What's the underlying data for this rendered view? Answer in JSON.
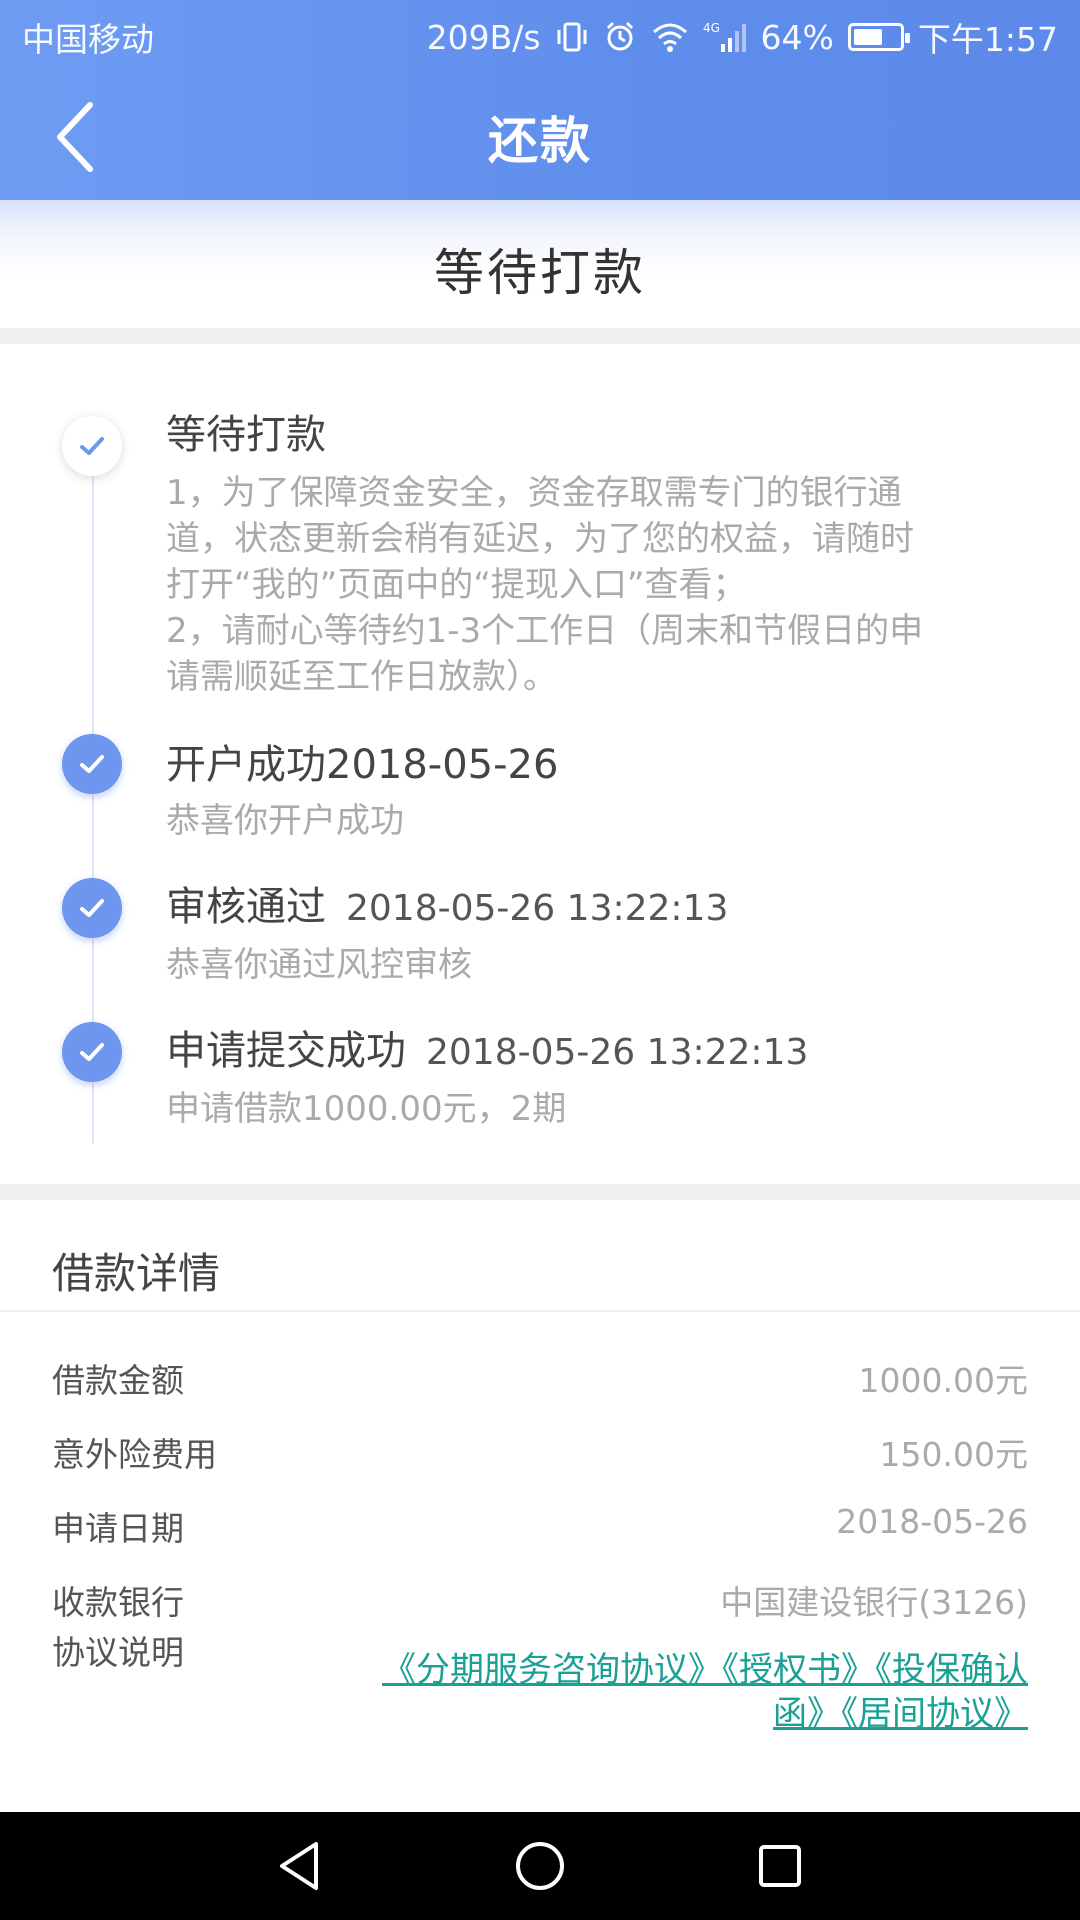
{
  "status_bar": {
    "carrier": "中国移动",
    "speed": "209B/s",
    "network": "4G",
    "battery": "64%",
    "battery_level": 0.64,
    "time": "下午1:57"
  },
  "nav": {
    "title": "还款"
  },
  "state": {
    "title": "等待打款"
  },
  "colors": {
    "header": "#5f8deb",
    "accent": "#6f96ee",
    "link": "#1aa095"
  },
  "steps": [
    {
      "title": "等待打款",
      "timestamp": "",
      "desc_lines": [
        "1，为了保障资金安全，资金存取需专门的银行通",
        "道，状态更新会稍有延迟，为了您的权益，请随时",
        "打开“我的”页面中的“提现入口”查看；",
        "2，请耐心等待约1-3个工作日（周末和节假日的申",
        "请需顺延至工作日放款）。"
      ],
      "status": "pending"
    },
    {
      "title": "开户成功2018-05-26",
      "timestamp": "",
      "desc_lines": [
        "恭喜你开户成功"
      ],
      "status": "done"
    },
    {
      "title": "审核通过",
      "timestamp": "2018-05-26 13:22:13",
      "desc_lines": [
        "恭喜你通过风控审核"
      ],
      "status": "done"
    },
    {
      "title": "申请提交成功",
      "timestamp": "2018-05-26 13:22:13",
      "desc_lines": [
        "申请借款1000.00元，2期"
      ],
      "status": "done"
    }
  ],
  "details": {
    "title": "借款详情",
    "rows": [
      {
        "label": "借款金额",
        "value": "1000.00元"
      },
      {
        "label": "意外险费用",
        "value": "150.00元"
      },
      {
        "label": "申请日期",
        "value": "2018-05-26"
      },
      {
        "label": "收款银行",
        "value": "中国建设银行(3126)"
      }
    ],
    "agreement_label": "协议说明",
    "agreement_line1": "《分期服务咨询协议》《授权书》《投保确认",
    "agreement_line2": "函》《居间协议》"
  }
}
